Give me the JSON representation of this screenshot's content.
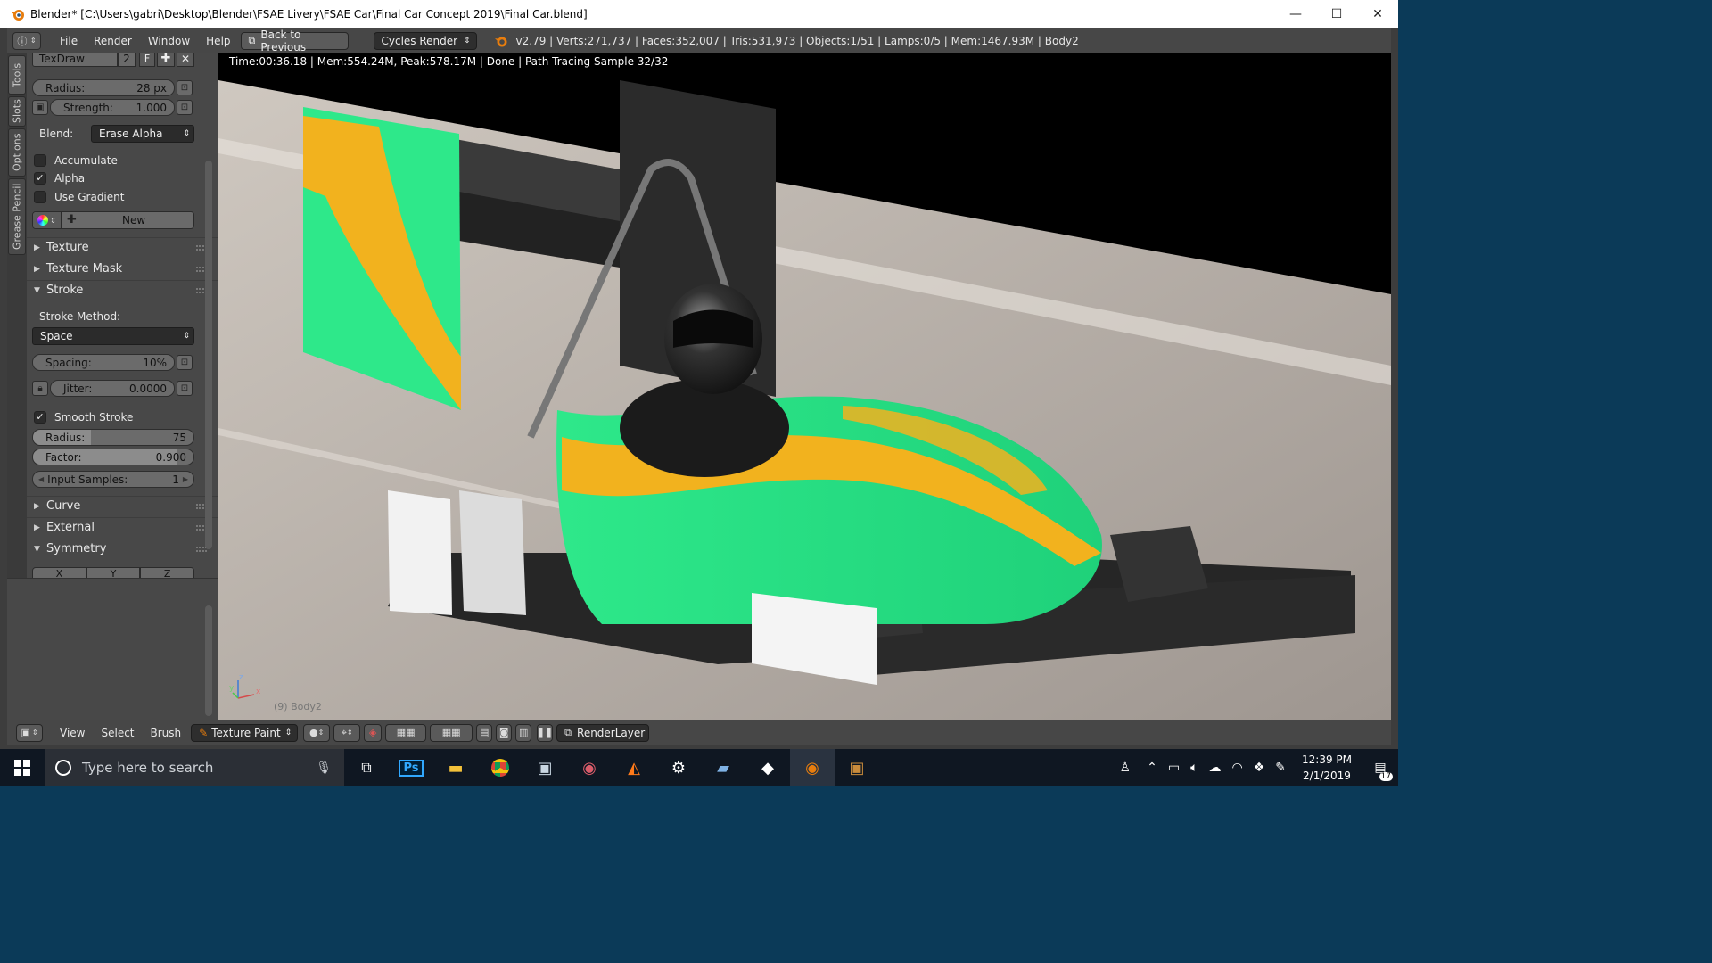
{
  "window": {
    "title": "Blender* [C:\\Users\\gabri\\Desktop\\Blender\\FSAE Livery\\FSAE Car\\Final Car Concept 2019\\Final Car.blend]",
    "minimize": "—",
    "maximize": "☐",
    "close": "✕"
  },
  "infobar": {
    "editor_icon": "ⓘ",
    "menus": [
      "File",
      "Render",
      "Window",
      "Help"
    ],
    "back_button": "Back to Previous",
    "engine": "Cycles Render",
    "stats": "v2.79 | Verts:271,737 | Faces:352,007 | Tris:531,973 | Objects:1/51 | Lamps:0/5 | Mem:1467.93M | Body2"
  },
  "tabs": [
    "Tools",
    "Slots",
    "Options",
    "Grease Pencil"
  ],
  "brush": {
    "name": "TexDraw",
    "users": "2",
    "fake": "F",
    "radius_label": "Radius:",
    "radius_value": "28 px",
    "strength_label": "Strength:",
    "strength_value": "1.000",
    "blend_label": "Blend:",
    "blend_value": "Erase Alpha",
    "accumulate": "Accumulate",
    "alpha": "Alpha",
    "use_gradient": "Use Gradient",
    "new_label": "New"
  },
  "panels": {
    "texture": "Texture",
    "texture_mask": "Texture Mask",
    "stroke": "Stroke",
    "curve": "Curve",
    "external": "External",
    "symmetry": "Symmetry"
  },
  "stroke": {
    "method_label": "Stroke Method:",
    "method_value": "Space",
    "spacing_label": "Spacing:",
    "spacing_value": "10%",
    "jitter_label": "Jitter:",
    "jitter_value": "0.0000",
    "smooth_label": "Smooth Stroke",
    "smooth_radius_label": "Radius:",
    "smooth_radius_value": "75",
    "factor_label": "Factor:",
    "factor_value": "0.900",
    "input_samples_label": "Input Samples:",
    "input_samples_value": "1"
  },
  "symmetry_axes": [
    "X",
    "Y",
    "Z"
  ],
  "viewport": {
    "render_info": "Time:00:36.18 | Mem:554.24M, Peak:578.17M | Done | Path Tracing Sample 32/32",
    "object_label": "(9) Body2",
    "axis_z": "z",
    "axis_x": "x",
    "axis_y": "y"
  },
  "bottombar": {
    "view": "View",
    "select": "Select",
    "brush": "Brush",
    "mode": "Texture Paint",
    "render_layer": "RenderLayer"
  },
  "taskbar": {
    "search_placeholder": "Type here to search",
    "time": "12:39 PM",
    "date": "2/1/2019",
    "notifications": "17"
  },
  "colors": {
    "livery_green": "#2ee88a",
    "livery_orange": "#f2b21e",
    "blender_orange": "#e87d0d",
    "taskbar": "#0f1722"
  }
}
